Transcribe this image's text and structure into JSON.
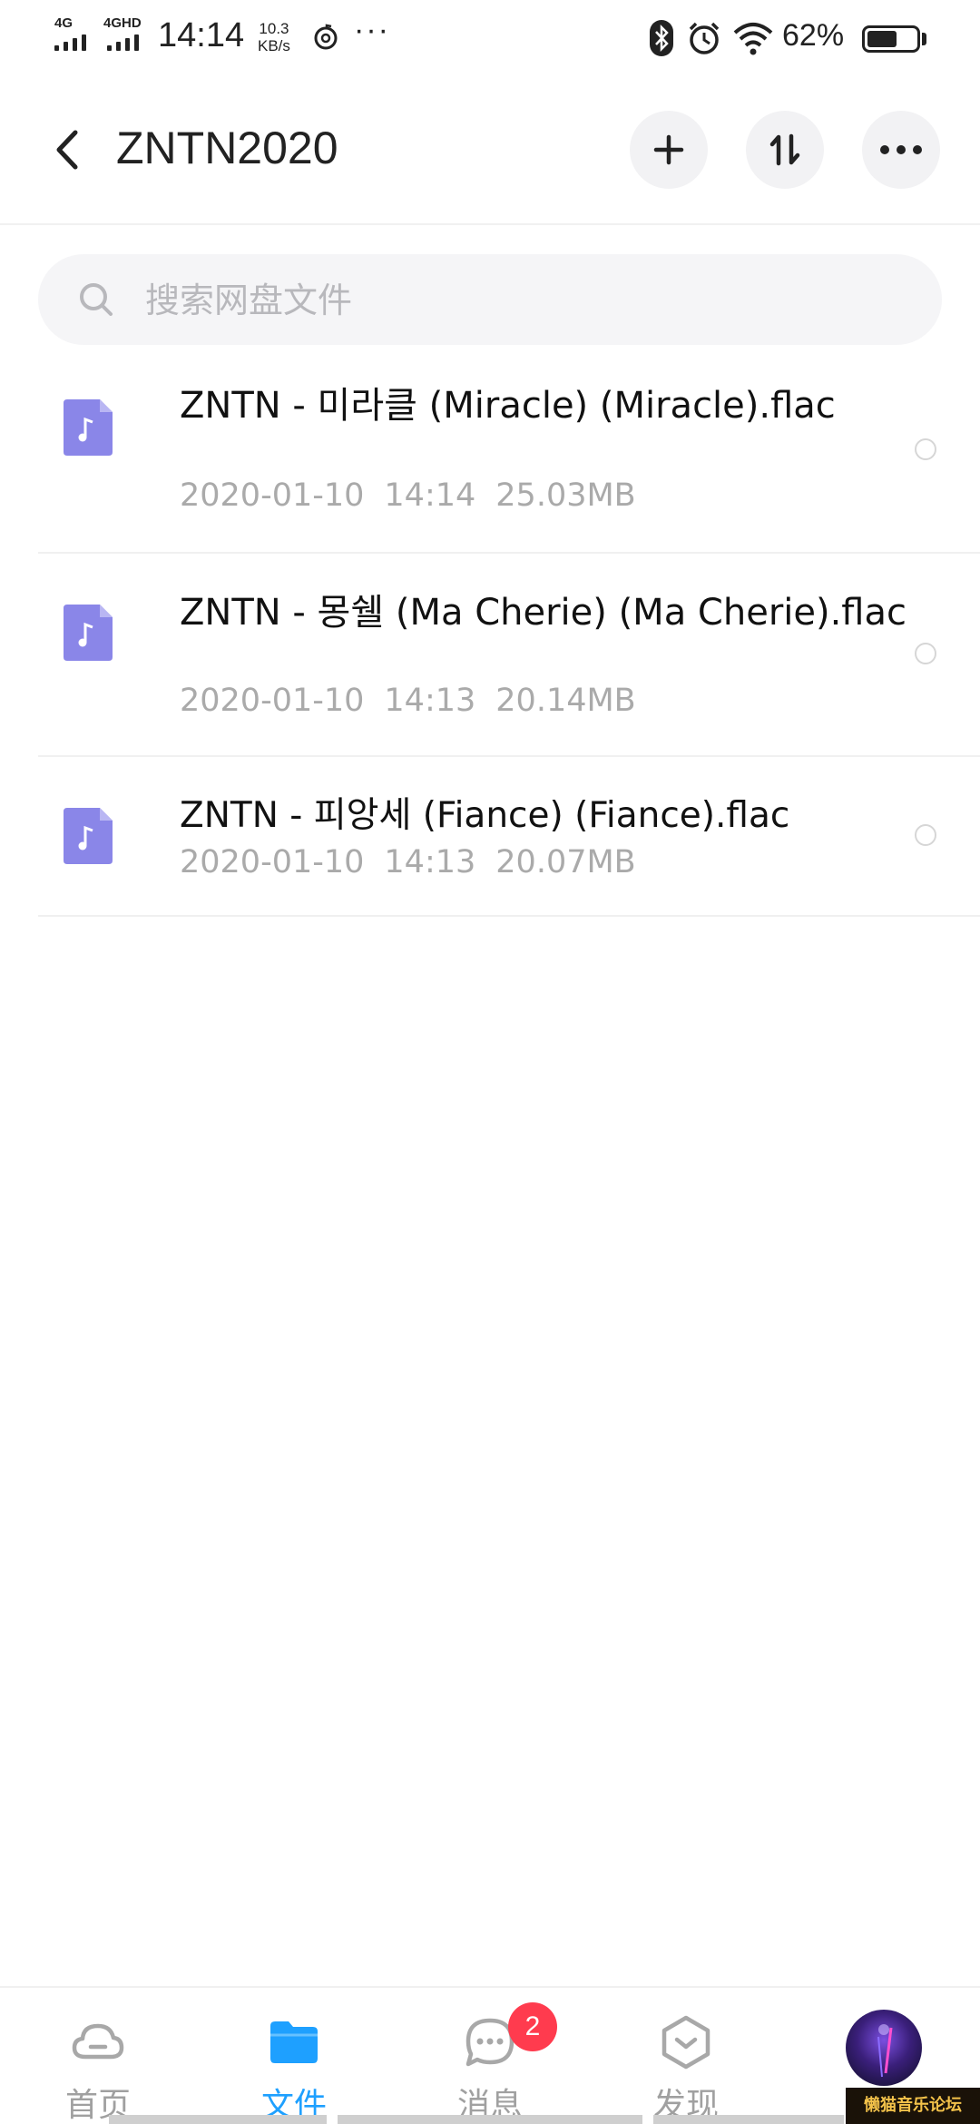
{
  "status_bar": {
    "network_1": "4G",
    "network_2": "4GHD",
    "time": "14:14",
    "speed_value": "10.3",
    "speed_unit": "KB/s",
    "more": "···",
    "battery": "62%",
    "battery_level_percent": 62,
    "icons": [
      "bluetooth-icon",
      "alarm-icon",
      "wifi-icon",
      "battery-icon"
    ]
  },
  "header": {
    "title": "ZNTN2020",
    "icons": [
      "back-icon",
      "plus-icon",
      "sort-icon",
      "more-icon"
    ]
  },
  "search": {
    "placeholder": "搜索网盘文件"
  },
  "files": [
    {
      "name": "ZNTN - 미라클 (Miracle) (Miracle).flac",
      "date": "2020-01-10",
      "time": "14:14",
      "size": "25.03MB",
      "icon": "music-file-icon"
    },
    {
      "name": "ZNTN - 몽쉘 (Ma Cherie) (Ma Cherie).flac",
      "date": "2020-01-10",
      "time": "14:13",
      "size": "20.14MB",
      "icon": "music-file-icon"
    },
    {
      "name": "ZNTN - 피앙세 (Fiance) (Fiance).flac",
      "date": "2020-01-10",
      "time": "14:13",
      "size": "20.07MB",
      "icon": "music-file-icon"
    }
  ],
  "nav": {
    "items": [
      {
        "label": "首页",
        "icon": "cloud-home-icon",
        "active": false
      },
      {
        "label": "文件",
        "icon": "folder-icon",
        "active": true
      },
      {
        "label": "消息",
        "icon": "message-icon",
        "active": false,
        "badge": "2"
      },
      {
        "label": "发现",
        "icon": "discover-icon",
        "active": false
      },
      {
        "label": "",
        "icon": "avatar",
        "active": false
      }
    ]
  },
  "watermark": "懒猫音乐论坛",
  "colors": {
    "accent": "#1ea0ff",
    "file_icon": "#8a86e8",
    "badge": "#ff3b4e"
  }
}
